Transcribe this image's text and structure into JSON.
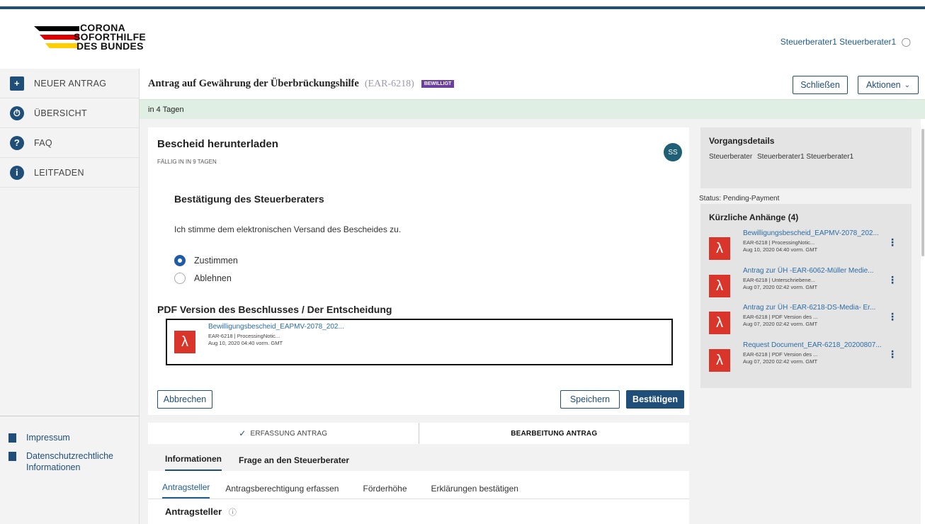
{
  "logo": {
    "line1": "CORONA",
    "line2": "SOFORTHILFE",
    "line3": "DES BUNDES"
  },
  "header": {
    "user_name": "Steuerberater1 Steuerberater1"
  },
  "sidebar": {
    "items": [
      {
        "label": "NEUER ANTRAG",
        "icon": "+"
      },
      {
        "label": "ÜBERSICHT",
        "icon": "⏱"
      },
      {
        "label": "FAQ",
        "icon": "?"
      },
      {
        "label": "LEITFADEN",
        "icon": "i"
      }
    ],
    "footer": [
      {
        "label": "Impressum"
      },
      {
        "label": "Datenschutzrechtliche Informationen"
      }
    ]
  },
  "title": {
    "text": "Antrag auf Gewährung der Überbrückungshilfe",
    "id": "(EAR-6218)",
    "badge": "BEWILLIGT"
  },
  "actions": {
    "close": "Schließen",
    "menu": "Aktionen"
  },
  "banner": {
    "text": "in 4 Tagen"
  },
  "task": {
    "title": "Bescheid herunterladen",
    "due": "FÄLLIG IN IN 9 TAGEN",
    "avatar": "SS",
    "section_title": "Bestätigung des Steuerberaters",
    "prompt": "Ich stimme dem elektronischen Versand des Bescheides zu.",
    "options": [
      {
        "label": "Zustimmen",
        "selected": true
      },
      {
        "label": "Ablehnen",
        "selected": false
      }
    ],
    "pdf_heading": "PDF Version des Beschlusses / Der Entscheidung",
    "file": {
      "name": "Bewilligungsbescheid_EAPMV-2078_202...",
      "meta": "EAR-6218 | ProcessingNotic...",
      "date": "Aug 10, 2020 04:40 vorm. GMT"
    },
    "cancel": "Abbrechen",
    "save": "Speichern",
    "confirm": "Bestätigen"
  },
  "steps": [
    {
      "label": "ERFASSUNG ANTRAG",
      "done": true
    },
    {
      "label": "BEARBEITUNG ANTRAG",
      "done": false
    }
  ],
  "tabs": [
    "Informationen",
    "Frage an den Steuerberater"
  ],
  "subtabs": [
    "Antragsteller",
    "Antragsberechtigung erfassen",
    "Förderhöhe",
    "Erklärungen bestätigen"
  ],
  "section": {
    "title": "Antragsteller"
  },
  "details": {
    "title": "Vorgangsdetails",
    "role": "Steuerberater",
    "name": "Steuerberater1 Steuerberater1",
    "status": "Status:  Pending-Payment"
  },
  "attachments": {
    "title": "Kürzliche Anhänge (4)",
    "items": [
      {
        "name": "Bewilligungsbescheid_EAPMV-2078_202...",
        "meta": "EAR-6218 | ProcessingNotic...",
        "date": "Aug 10, 2020 04:40 vorm. GMT"
      },
      {
        "name": "Antrag zur ÜH -EAR-6062-Müller Medie...",
        "meta": "EAR-6218 | Unterschriebene...",
        "date": "Aug 07, 2020 02:42 vorm. GMT"
      },
      {
        "name": "Antrag zur ÜH -EAR-6218-DS-Media- Er...",
        "meta": "EAR-6218 | PDF Version des ...",
        "date": "Aug 07, 2020 02:42 vorm. GMT"
      },
      {
        "name": "Request Document_EAR-6218_20200807...",
        "meta": "EAR-6218 | PDF Version des ...",
        "date": "Aug 07, 2020 02:42 vorm. GMT"
      }
    ]
  },
  "colors": {
    "brand": "#1f4e79",
    "badge": "#6a3fa0",
    "pdf": "#d9352a",
    "banner": "#dfefe3"
  }
}
